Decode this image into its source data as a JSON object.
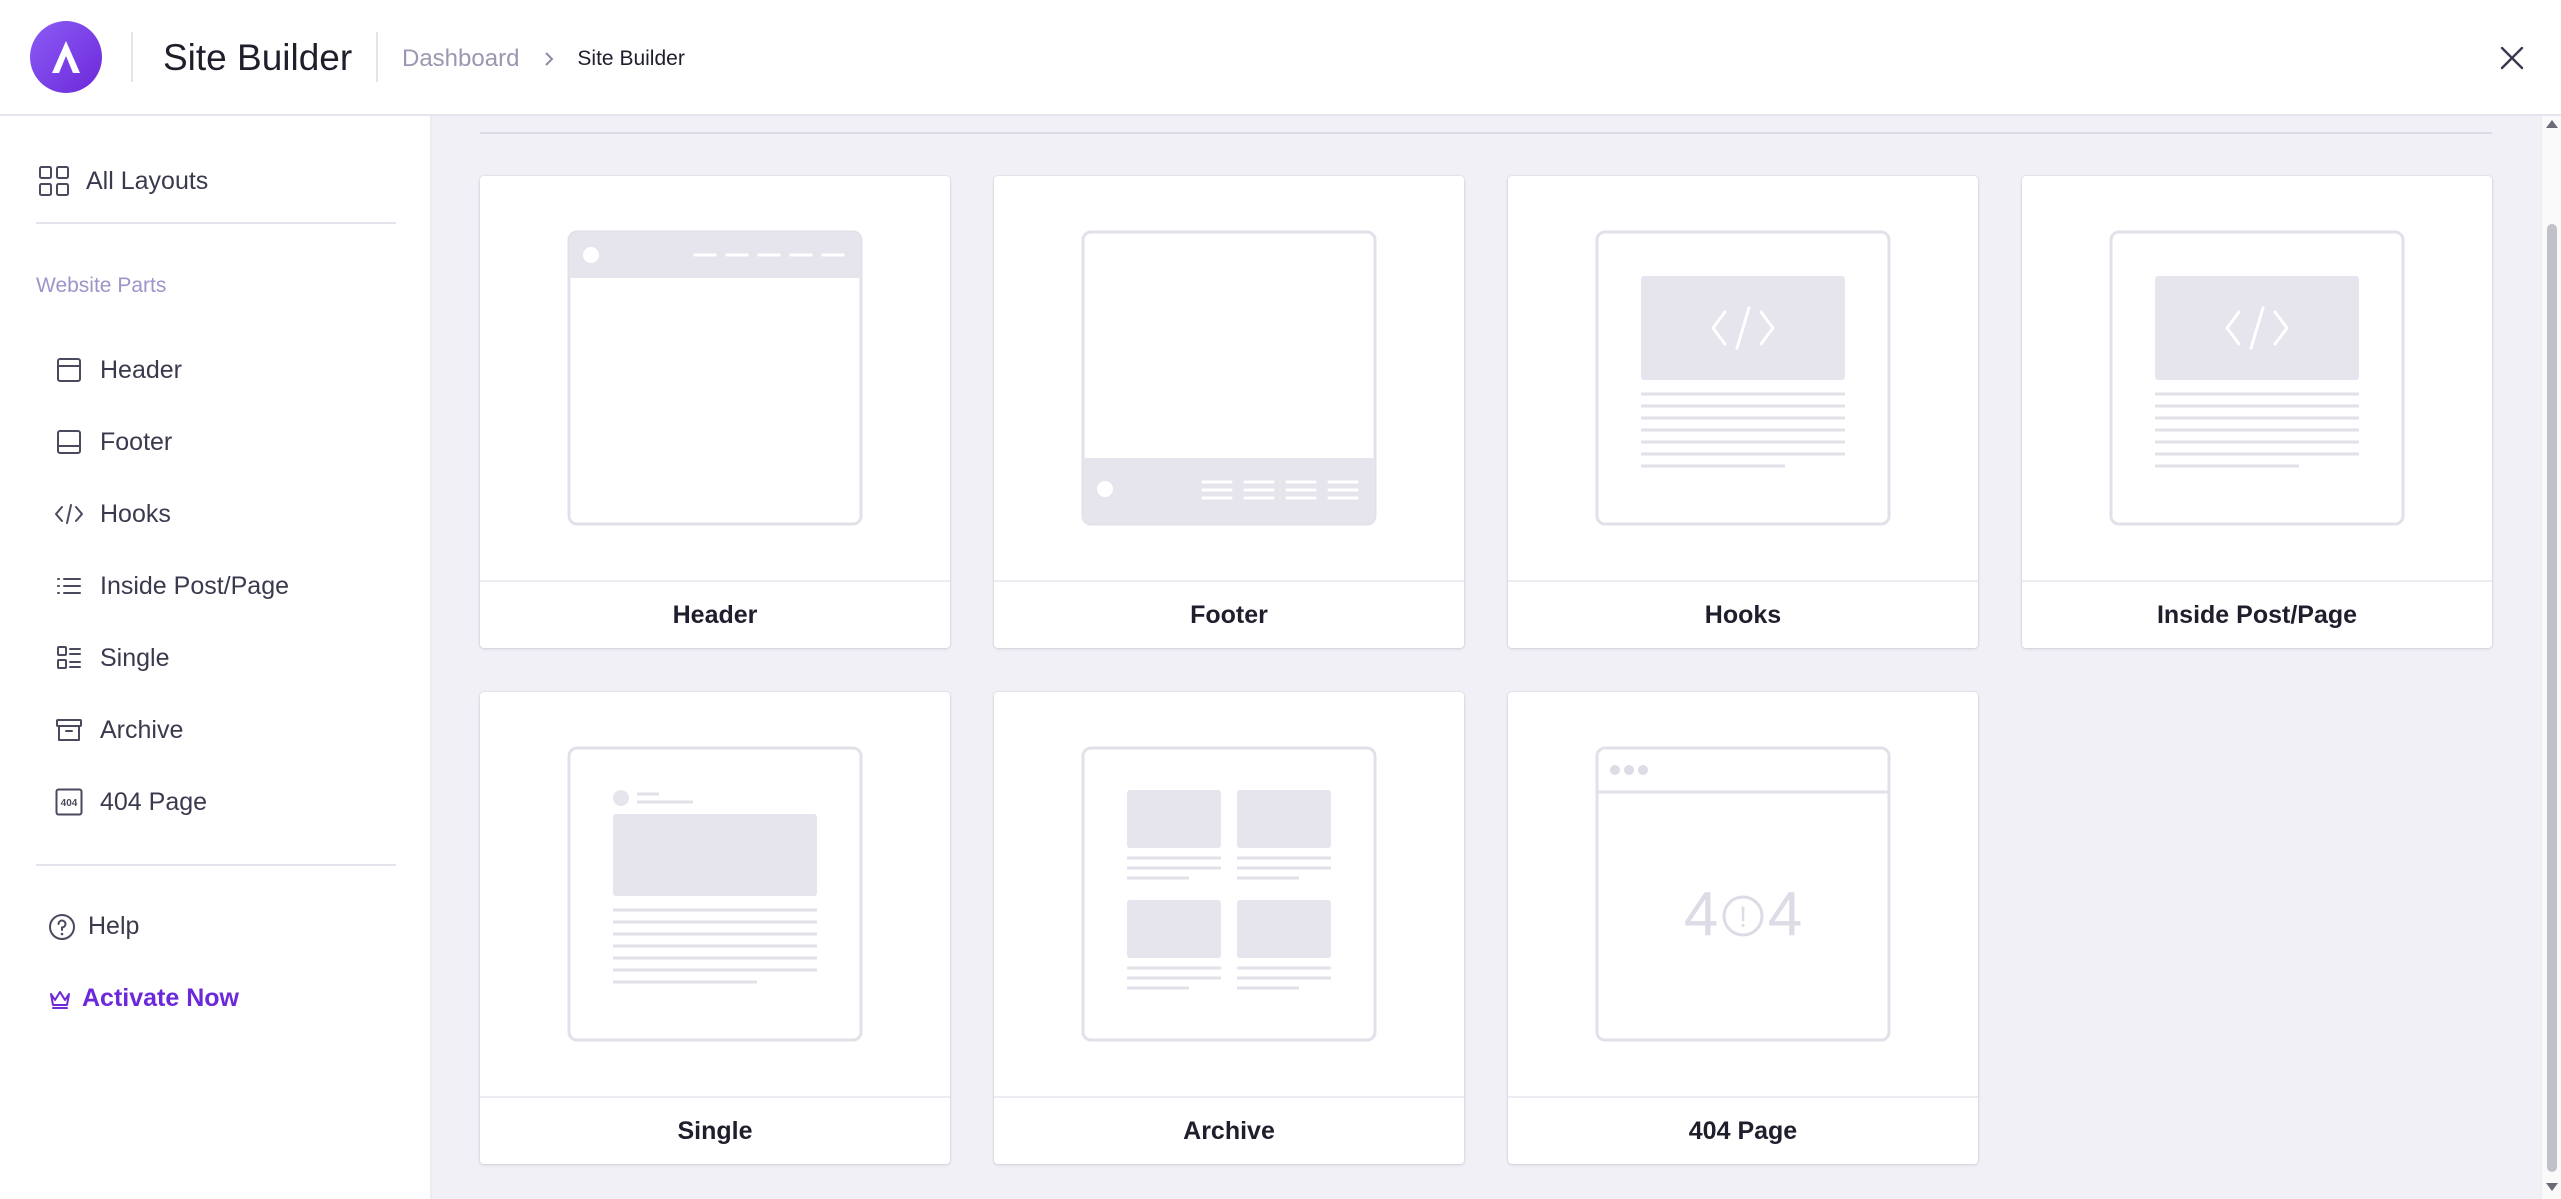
{
  "app": {
    "title": "Site Builder",
    "logo_icon": "astra-logo-icon",
    "brand_color": "#7c3aed"
  },
  "breadcrumb": {
    "parent": "Dashboard",
    "current": "Site Builder"
  },
  "sidebar": {
    "all_layouts": "All Layouts",
    "section_title": "Website Parts",
    "items": [
      {
        "label": "Header",
        "icon": "header-layout-icon"
      },
      {
        "label": "Footer",
        "icon": "footer-layout-icon"
      },
      {
        "label": "Hooks",
        "icon": "code-icon"
      },
      {
        "label": "Inside Post/Page",
        "icon": "list-icon"
      },
      {
        "label": "Single",
        "icon": "single-post-icon"
      },
      {
        "label": "Archive",
        "icon": "archive-box-icon"
      },
      {
        "label": "404 Page",
        "icon": "404-icon"
      }
    ],
    "help": "Help",
    "activate": "Activate Now",
    "activate_color": "#6d28d9"
  },
  "cards": [
    {
      "label": "Header",
      "preview": "header-preview"
    },
    {
      "label": "Footer",
      "preview": "footer-preview"
    },
    {
      "label": "Hooks",
      "preview": "hooks-preview"
    },
    {
      "label": "Inside Post/Page",
      "preview": "inside-post-preview"
    },
    {
      "label": "Single",
      "preview": "single-preview"
    },
    {
      "label": "Archive",
      "preview": "archive-preview"
    },
    {
      "label": "404 Page",
      "preview": "404-preview",
      "preview_text_left": "4",
      "preview_text_right": "4",
      "preview_mark": "!"
    }
  ]
}
